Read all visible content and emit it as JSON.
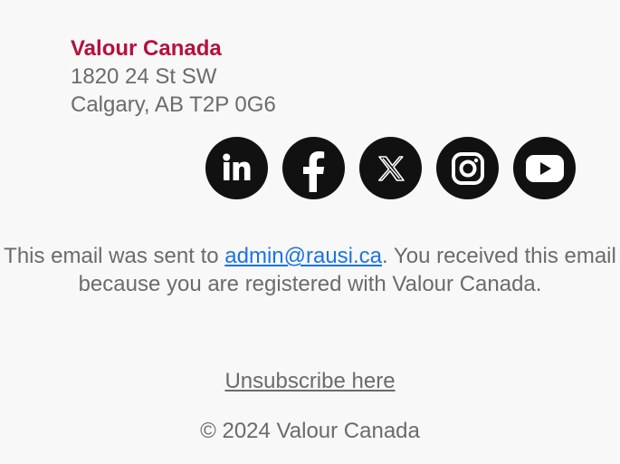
{
  "organization": {
    "name": "Valour Canada",
    "address_line1": "1820 24 St SW",
    "address_line2": "Calgary, AB T2P 0G6"
  },
  "social": [
    {
      "icon": "linkedin-icon"
    },
    {
      "icon": "facebook-icon"
    },
    {
      "icon": "x-icon"
    },
    {
      "icon": "instagram-icon"
    },
    {
      "icon": "youtube-icon"
    }
  ],
  "notice": {
    "prefix": "This email was sent to ",
    "email": "admin@rausi.ca",
    "suffix": ". You received this email because you are registered with Valour Canada."
  },
  "unsubscribe": {
    "label": "Unsubscribe here"
  },
  "copyright": "© 2024 Valour Canada",
  "colors": {
    "brand": "#b5103c",
    "text": "#6b6b6b",
    "link": "#1a73e8",
    "background": "#f8f8f8",
    "icon_bg": "#111111"
  }
}
